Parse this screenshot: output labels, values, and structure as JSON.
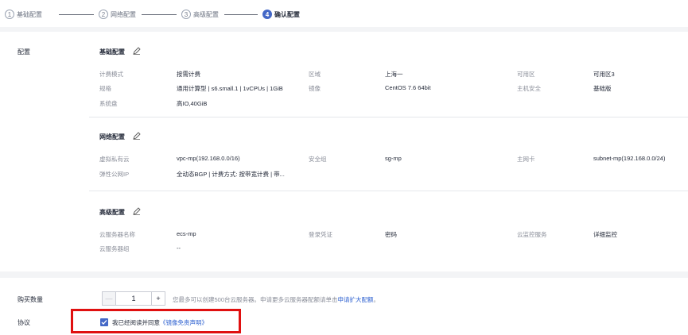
{
  "steps": [
    {
      "num": "1",
      "label": "基础配置"
    },
    {
      "num": "2",
      "label": "网络配置"
    },
    {
      "num": "3",
      "label": "高级配置"
    },
    {
      "num": "4",
      "label": "确认配置"
    }
  ],
  "config_label": "配置",
  "basic": {
    "title": "基础配置",
    "billing_label": "计费模式",
    "billing_value": "按需计费",
    "region_label": "区域",
    "region_value": "上海一",
    "az_label": "可用区",
    "az_value": "可用区3",
    "spec_label": "规格",
    "spec_value": "通用计算型 | s6.small.1 | 1vCPUs | 1GiB",
    "image_label": "镜像",
    "image_value": "CentOS 7.6 64bit",
    "host_security_label": "主机安全",
    "host_security_value": "基础版",
    "disk_label": "系统盘",
    "disk_value": "高IO,40GiB"
  },
  "network": {
    "title": "网络配置",
    "vpc_label": "虚拟私有云",
    "vpc_value": "vpc-mp(192.168.0.0/16)",
    "sg_label": "安全组",
    "sg_value": "sg-mp",
    "nic_label": "主网卡",
    "nic_value": "subnet-mp(192.168.0.0/24)",
    "eip_label": "弹性公网IP",
    "eip_value": "全动态BGP | 计费方式: 按带宽计费 | 带..."
  },
  "advanced": {
    "title": "高级配置",
    "name_label": "云服务器名称",
    "name_value": "ecs-mp",
    "login_label": "登录凭证",
    "login_value": "密码",
    "monitor_label": "云监控服务",
    "monitor_value": "详细监控",
    "group_label": "云服务器组",
    "group_value": "--"
  },
  "purchase": {
    "qty_label": "购买数量",
    "minus": "—",
    "qty_value": "1",
    "plus": "+",
    "hint": "您最多可以创建500台云服务器。申请更多云服务器配额请单击",
    "hint_link": "申请扩大配额",
    "hint_end": "。"
  },
  "agreement": {
    "label": "协议",
    "text": "我已经阅读并同意",
    "link": "《镜像免责声明》"
  }
}
